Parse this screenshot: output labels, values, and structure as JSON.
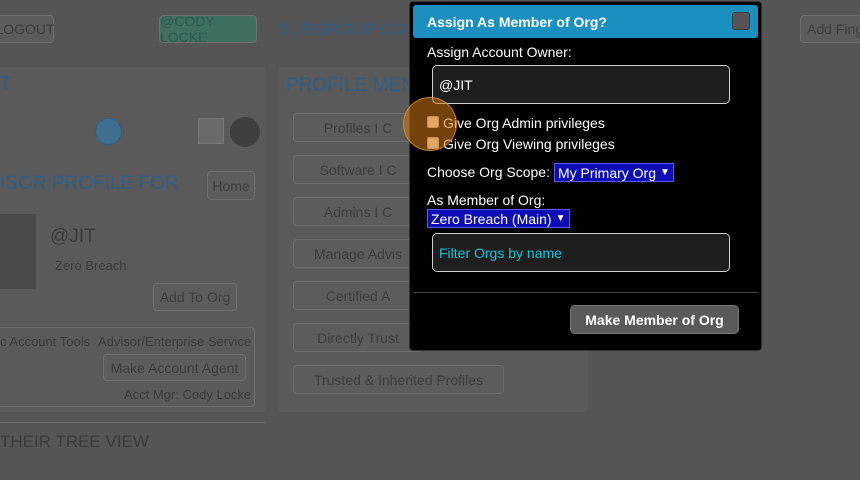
{
  "background": {
    "logout": "LOGOUT",
    "user_badge": "@CODY LOCKE",
    "subgroup": "SUBGROUP CONN",
    "add_fing": "Add Fing",
    "heading_t": "T",
    "profile_menu": "PROFILE MENU",
    "advisor_profile": "ISOR PROFILE FOR",
    "home": "Home",
    "handle": "@JIT",
    "org_name": "Zero Breach",
    "add_to_org": "Add To Org",
    "account_tools": "c Account Tools",
    "advisor_service": "Advisor/Enterprise Service",
    "make_agent": "Make Account Agent",
    "acct_mgr": "Acct Mgr: Cody Locke",
    "tree_view": "THEIR TREE VIEW",
    "menu_items": [
      "Profiles I C",
      "Software I C",
      "Admins I C",
      "Manage Advis",
      "Certified A",
      "Directly Trust",
      "Trusted & Inherited Profiles"
    ]
  },
  "modal": {
    "title": "Assign As Member of Org?",
    "owner_label": "Assign Account Owner:",
    "owner_value": "@JIT",
    "admin_privileges": "Give Org Admin privileges",
    "viewing_privileges": "Give Org Viewing privileges",
    "scope_label": "Choose Org Scope:",
    "scope_value": "My Primary Org",
    "member_label": "As Member of Org:",
    "member_value": "Zero Breach (Main)",
    "filter_placeholder": "Filter Orgs by name",
    "submit": "Make Member of Org"
  }
}
